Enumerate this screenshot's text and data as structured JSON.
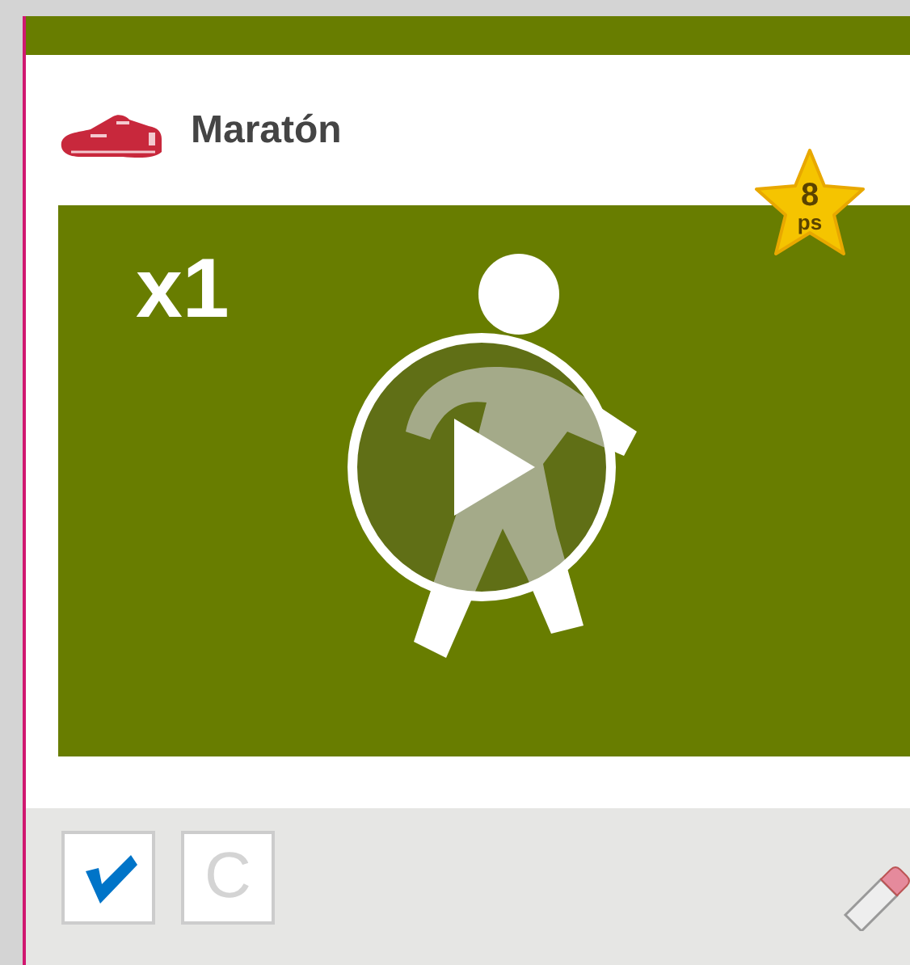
{
  "card": {
    "title": "Maratón",
    "points": {
      "value": "8",
      "unit": "ps"
    },
    "video": {
      "multiplier": "x1"
    },
    "footer": {
      "done_toggle": {
        "checked": true
      },
      "c_button": {
        "label": "C",
        "disabled": true
      }
    }
  }
}
